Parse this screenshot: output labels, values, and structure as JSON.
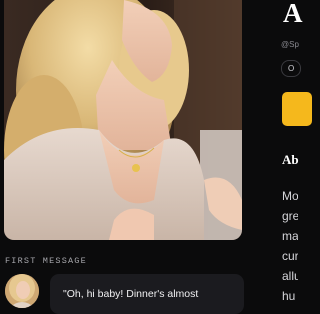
{
  "character": {
    "name_partial": "A",
    "handle_partial": "@Sp",
    "tag_partial": "O"
  },
  "about": {
    "heading_partial": "Ab",
    "lines_partial": [
      "Mo",
      "gre",
      "ma",
      "cur",
      "allu",
      "hu"
    ]
  },
  "first_message": {
    "label": "FIRST MESSAGE",
    "text": "\"Oh, hi baby! Dinner's almost"
  },
  "colors": {
    "background": "#0b0b0c",
    "accent": "#f5b81c",
    "bubble": "#1b1b1f"
  }
}
